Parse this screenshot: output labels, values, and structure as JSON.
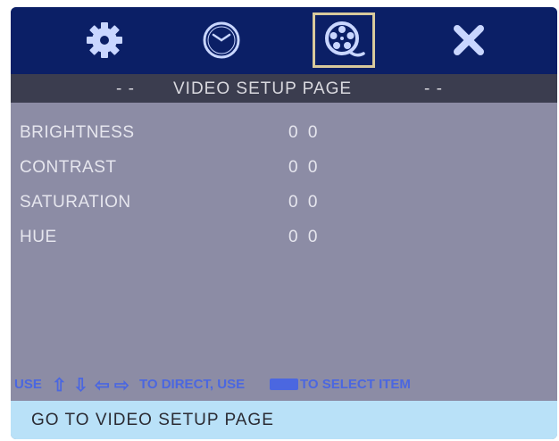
{
  "icons": [
    {
      "name": "gear-icon",
      "selected": false
    },
    {
      "name": "clock-icon",
      "selected": false
    },
    {
      "name": "film-reel-icon",
      "selected": true
    },
    {
      "name": "close-icon",
      "selected": false
    }
  ],
  "title": {
    "left_dashes": "- -",
    "text": "VIDEO SETUP PAGE",
    "right_dashes": "- -"
  },
  "menu": [
    {
      "label": "BRIGHTNESS",
      "value": "0 0"
    },
    {
      "label": "CONTRAST",
      "value": "0 0"
    },
    {
      "label": "SATURATION",
      "value": "0 0"
    },
    {
      "label": "HUE",
      "value": "0 0"
    }
  ],
  "hint": {
    "use1": "USE",
    "arrow_up": "⇧",
    "arrow_down": "⇩",
    "arrow_left": "⇦",
    "arrow_right": "⇨",
    "to_direct": "TO DIRECT, USE",
    "to_select": "TO SELECT ITEM"
  },
  "status": "GO TO VIDEO SETUP PAGE",
  "colors": {
    "icon_bar": "#0b1f66",
    "panel": "#8c8ca5",
    "title_bar": "#3b3d4f",
    "hint": "#4b67e0",
    "status_bar": "#b9e1f8",
    "icon_light": "#c9d6ff",
    "selection_frame": "#d8c99c"
  }
}
